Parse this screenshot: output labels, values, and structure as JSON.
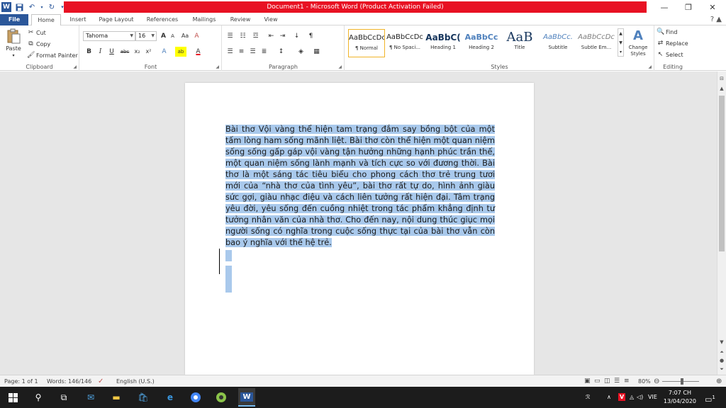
{
  "titlebar": {
    "title": "Document1 - Microsoft Word (Product Activation Failed)",
    "minimize": "—",
    "restore": "❐",
    "close": "✕"
  },
  "tabs": {
    "file": "File",
    "home": "Home",
    "insert": "Insert",
    "page_layout": "Page Layout",
    "references": "References",
    "mailings": "Mailings",
    "review": "Review",
    "view": "View"
  },
  "clipboard": {
    "paste": "Paste",
    "cut": "Cut",
    "copy": "Copy",
    "format_painter": "Format Painter",
    "label": "Clipboard"
  },
  "font": {
    "name": "Tahoma",
    "size": "16",
    "label": "Font",
    "bold": "B",
    "italic": "I",
    "underline": "U",
    "strike": "abc",
    "subscript": "x₂",
    "superscript": "x²",
    "grow": "A",
    "shrink": "A",
    "change_case": "Aa",
    "clear": "A",
    "text_effects": "A",
    "highlight": "ab",
    "font_color": "A"
  },
  "paragraph": {
    "label": "Paragraph"
  },
  "styles": {
    "label": "Styles",
    "items": [
      {
        "sample": "AaBbCcDc",
        "name": "¶ Normal"
      },
      {
        "sample": "AaBbCcDc",
        "name": "¶ No Spaci..."
      },
      {
        "sample": "AaBbC(",
        "name": "Heading 1"
      },
      {
        "sample": "AaBbCc",
        "name": "Heading 2"
      },
      {
        "sample": "AaB",
        "name": "Title"
      },
      {
        "sample": "AaBbCc.",
        "name": "Subtitle"
      },
      {
        "sample": "AaBbCcDc",
        "name": "Subtle Em..."
      }
    ],
    "change_styles": "Change Styles"
  },
  "editing": {
    "label": "Editing",
    "find": "Find",
    "replace": "Replace",
    "select": "Select"
  },
  "document": {
    "body": "Bài thơ Vội vàng thể hiện tam trạng đắm say bồng bột của một tấm lòng ham sống mãnh liệt. Bài thơ còn thể hiện một quan niệm sống sống gấp gáp vội vàng tận hưởng những hạnh phúc trần thế, một quan niệm sống lành mạnh và tích cực so với đương thời. Bài thơ là một sáng tác tiêu biểu cho phong cách thơ trẻ trung tươi mới của “nhà thơ của tình yêu”, bài thơ rất tự do, hình ảnh giàu sức gợi, giàu nhạc điệu và cách liên tưởng rất hiện đại. Tâm trạng yêu đời, yêu sống đến cuồng nhiệt trong tác phẩm khẳng định tư tưởng nhân văn của nhà thơ. Cho đến nay, nội dung thúc giục mọi người sống có nghĩa trong cuộc sống thực tại của bài thơ vẫn còn bao ý nghĩa với thế hệ trẻ."
  },
  "statusbar": {
    "page": "Page: 1 of 1",
    "words": "Words: 146/146",
    "language": "English (U.S.)",
    "zoom": "80%"
  },
  "taskbar": {
    "lang": "VIE",
    "time": "7:07 CH",
    "date": "13/04/2020",
    "notif_count": "1"
  },
  "colors": {
    "title_red": "#e81123",
    "word_blue": "#2b579a",
    "selection": "#a9c9ec"
  }
}
